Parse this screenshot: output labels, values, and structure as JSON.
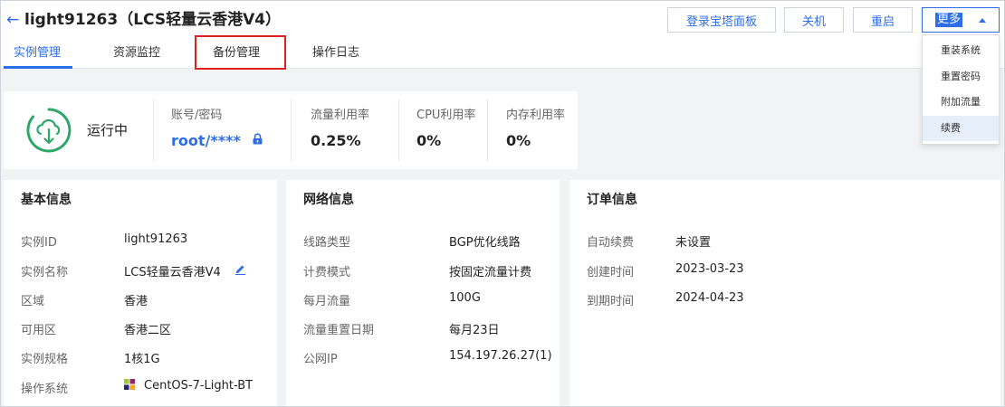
{
  "header": {
    "title": "light91263（LCS轻量云香港V4）",
    "buttons": {
      "baota": "登录宝塔面板",
      "shutdown": "关机",
      "restart": "重启",
      "more": "更多"
    },
    "tabs": [
      {
        "label": "实例管理",
        "active": true
      },
      {
        "label": "资源监控",
        "active": false
      },
      {
        "label": "备份管理",
        "active": false,
        "highlighted": true
      },
      {
        "label": "操作日志",
        "active": false
      }
    ]
  },
  "more_menu": {
    "items": [
      {
        "label": "重装系统"
      },
      {
        "label": "重置密码"
      },
      {
        "label": "附加流量"
      },
      {
        "label": "续费",
        "selected": true
      }
    ]
  },
  "status": {
    "state": "运行中",
    "account_label": "账号/密码",
    "account_value": "root/****",
    "traffic_label": "流量利用率",
    "traffic_value": "0.25%",
    "cpu_label": "CPU利用率",
    "cpu_value": "0%",
    "mem_label": "内存利用率",
    "mem_value": "0%"
  },
  "basic": {
    "title": "基本信息",
    "rows": [
      {
        "label": "实例ID",
        "value": "light91263"
      },
      {
        "label": "实例名称",
        "value": "LCS轻量云香港V4"
      },
      {
        "label": "区域",
        "value": "香港"
      },
      {
        "label": "可用区",
        "value": "香港二区"
      },
      {
        "label": "实例规格",
        "value": "1核1G"
      },
      {
        "label": "操作系统",
        "value": "CentOS-7-Light-BT"
      }
    ]
  },
  "network": {
    "title": "网络信息",
    "rows": [
      {
        "label": "线路类型",
        "value": "BGP优化线路"
      },
      {
        "label": "计费模式",
        "value": "按固定流量计费"
      },
      {
        "label": "每月流量",
        "value": "100G"
      },
      {
        "label": "流量重置日期",
        "value": "每月23日"
      },
      {
        "label": "公网IP",
        "value": "154.197.26.27(1)"
      }
    ]
  },
  "order": {
    "title": "订单信息",
    "rows": [
      {
        "label": "自动续费",
        "value": "未设置"
      },
      {
        "label": "创建时间",
        "value": "2023-03-23"
      },
      {
        "label": "到期时间",
        "value": "2024-04-23"
      }
    ]
  },
  "colors": {
    "accent": "#2d6ee8",
    "running_green": "#2ea869",
    "highlight_red": "#e0201f",
    "background": "#f2f3f5"
  },
  "icons": {
    "back": "arrow-left-icon",
    "status": "cloud-running-icon",
    "lock": "lock-icon",
    "edit": "pencil-icon",
    "os": "centos-logo-icon",
    "caret": "caret-up-icon"
  }
}
